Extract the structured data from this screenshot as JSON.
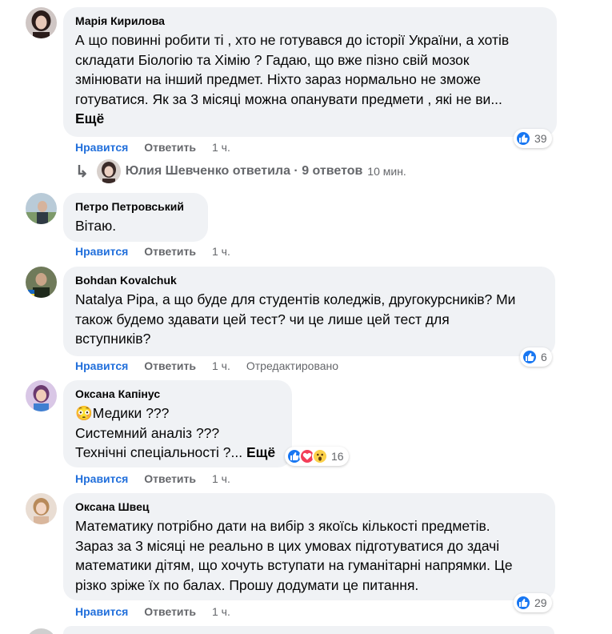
{
  "comments": [
    {
      "author": "Марія Кирилова",
      "lines": [
        "А що повинні робити ті , хто не готувався до історії України, а хотів",
        "складати Біологію та Хімію ? Гадаю, що вже пізно свій мозок",
        "змінювати на інший предмет. Ніхто зараз нормально не зможе",
        "готуватися. Як за 3 місяці можна опанувати предмети , які не ви..."
      ],
      "more": "Ещё",
      "like": "Нравится",
      "reply": "Ответить",
      "time": "1 ч.",
      "reactions": [
        "like-icon"
      ],
      "count": "39"
    },
    {
      "author": "Петро Петровський",
      "lines": [
        "Вітаю."
      ],
      "like": "Нравится",
      "reply": "Ответить",
      "time": "1 ч."
    },
    {
      "author": "Bohdan Kovalchuk",
      "lines": [
        "Natalya Pipa, а що буде для студентів коледжів, другокурсників? Ми",
        "також будемо здавати цей тест? чи це лише цей тест для",
        "вступників?"
      ],
      "like": "Нравится",
      "reply": "Ответить",
      "time": "1 ч.",
      "edited": "Отредактировано",
      "reactions": [
        "like-icon"
      ],
      "count": "6"
    },
    {
      "author": "Оксана Капінус",
      "lines": [
        "😳Медики ???",
        "Системний аналіз ???",
        "Технічні спеціальності ?..."
      ],
      "more": "Ещё",
      "like": "Нравится",
      "reply": "Ответить",
      "time": "1 ч.",
      "reactions": [
        "like-icon",
        "love-icon",
        "wow-icon"
      ],
      "count": "16"
    },
    {
      "author": "Оксана Швец",
      "lines": [
        "Математику потрібно дати на вибір з якоїсь кількості предметів.",
        "Зараз за 3 місяці не реально в цих умовах підготуватися до здачі",
        "математики дітям, що хочуть вступати на гуманітарні напрямки. Це",
        "різко зріже їх по балах. Прошу додумати це питання."
      ],
      "like": "Нравится",
      "reply": "Ответить",
      "time": "1 ч.",
      "reactions": [
        "like-icon"
      ],
      "count": "29"
    }
  ],
  "reply_thread": {
    "text": "Юлия Шевченко ответила · 9 ответов",
    "time": "10 мин."
  },
  "colors": {
    "bubble": "#f0f2f5",
    "like_blue": "#216fdb",
    "secondary": "#65676b"
  }
}
